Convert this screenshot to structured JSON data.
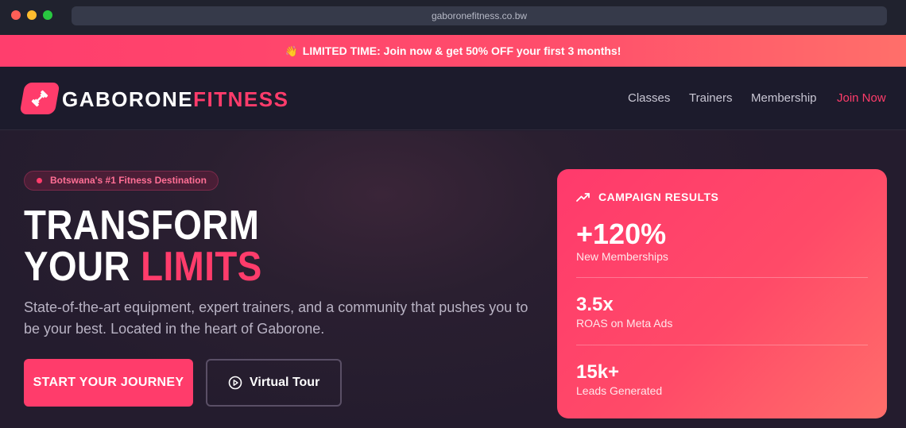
{
  "browser": {
    "url": "gaboronefitness.co.bw"
  },
  "promo": {
    "icon": "waving-hand-icon",
    "text": "LIMITED TIME: Join now & get 50% OFF your first 3 months!"
  },
  "header": {
    "logo_primary": "GABORONE",
    "logo_secondary": "FITNESS",
    "logo_icon": "dumbbell-icon",
    "nav": [
      {
        "label": "Classes"
      },
      {
        "label": "Trainers"
      },
      {
        "label": "Membership"
      },
      {
        "label": "Join Now"
      }
    ]
  },
  "hero": {
    "badge": "Botswana's #1 Fitness Destination",
    "title_line1": "TRANSFORM",
    "title_line2_a": "YOUR ",
    "title_line2_b": "LIMITS",
    "subtitle": "State-of-the-art equipment, expert trainers, and a community that pushes you to be your best. Located in the heart of Gaborone.",
    "primary_button": "START YOUR JOURNEY",
    "secondary_button": "Virtual Tour",
    "secondary_icon": "play-circle-icon"
  },
  "campaign": {
    "heading": "CAMPAIGN RESULTS",
    "heading_icon": "trending-up-icon",
    "stats": [
      {
        "value": "+120%",
        "label": "New Memberships"
      },
      {
        "value": "3.5x",
        "label": "ROAS on Meta Ads"
      },
      {
        "value": "15k+",
        "label": "Leads Generated"
      }
    ]
  },
  "colors": {
    "accent": "#ff3c6b",
    "header_bg": "#1c1b2c",
    "hero_bg": "#241c2e"
  }
}
